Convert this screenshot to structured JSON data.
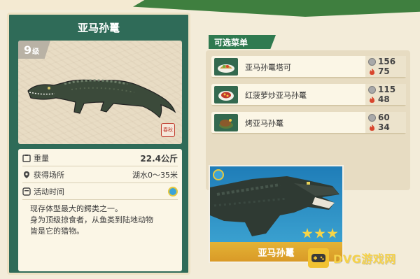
{
  "creature": {
    "name": "亚马孙鼍",
    "level_number": "9",
    "level_unit": "级",
    "seal_text": "春秋",
    "weight_label": "重量",
    "weight_value": "22.4公斤",
    "location_label": "获得场所",
    "location_value": "湖水0～35米",
    "activity_label": "活动时间",
    "description_lines": [
      "现存体型最大的鳄类之一。",
      "身为顶级掠食者，从鱼类到陆地动物",
      "皆是它的猎物。"
    ]
  },
  "menu": {
    "title": "可选菜单",
    "items": [
      {
        "name": "亚马孙鼍塔可",
        "price": "156",
        "heart": "75",
        "icon": "taco-dish-icon"
      },
      {
        "name": "红菠萝炒亚马孙鼍",
        "price": "115",
        "heart": "48",
        "icon": "pineapple-stirfry-dish-icon"
      },
      {
        "name": "烤亚马孙鼍",
        "price": "60",
        "heart": "34",
        "icon": "roast-dish-icon"
      }
    ]
  },
  "photo_card": {
    "name": "亚马孙鼍",
    "stars": 3
  },
  "watermark": {
    "text": "DVG游戏网"
  },
  "colors": {
    "panel_green": "#2f6b58",
    "accent_green": "#3f7f3f",
    "card_gold": "#d99a27",
    "heart_red": "#d8452c"
  }
}
